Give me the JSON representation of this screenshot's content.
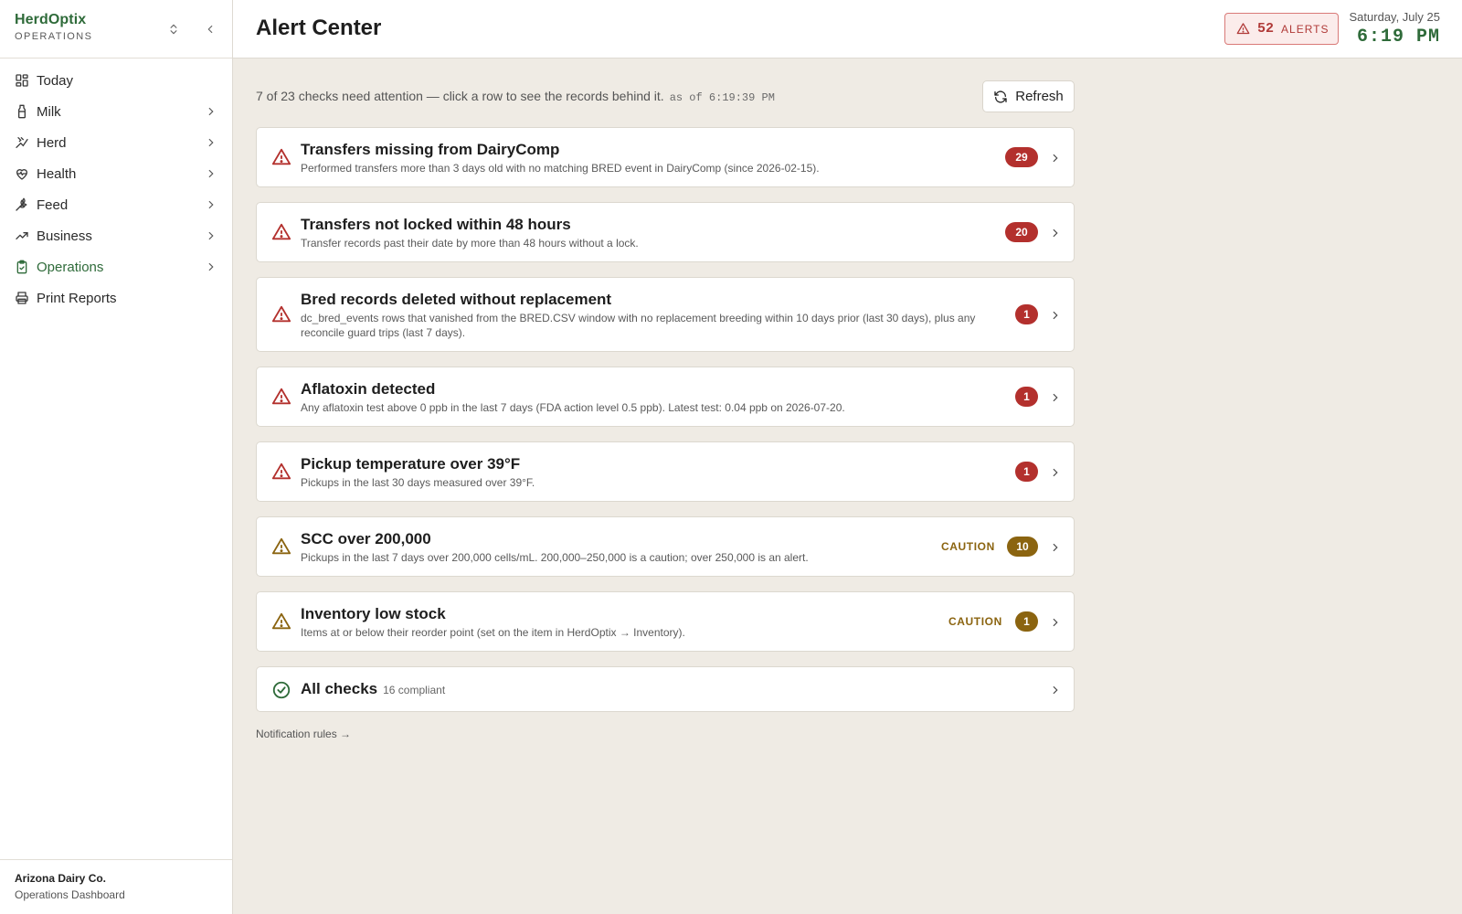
{
  "brand": {
    "name": "HerdOptix",
    "subtitle": "OPERATIONS"
  },
  "sidebar": {
    "items": [
      {
        "label": "Today",
        "icon": "dashboard-icon"
      },
      {
        "label": "Milk",
        "icon": "milk-bottle-icon"
      },
      {
        "label": "Herd",
        "icon": "cow-icon"
      },
      {
        "label": "Health",
        "icon": "heart-pulse-icon"
      },
      {
        "label": "Feed",
        "icon": "wheat-icon"
      },
      {
        "label": "Business",
        "icon": "trending-up-icon"
      },
      {
        "label": "Operations",
        "icon": "clipboard-check-icon"
      },
      {
        "label": "Print Reports",
        "icon": "printer-icon"
      }
    ],
    "footer": {
      "org": "Arizona Dairy Co.",
      "subtitle": "Operations Dashboard"
    }
  },
  "header": {
    "title": "Alert Center",
    "alerts": {
      "count": "52",
      "label": "ALERTS"
    },
    "date": "Saturday, July 25",
    "time": "6:19 PM"
  },
  "summary": {
    "text": "7 of 23 checks need attention — click a row to see the records behind it.",
    "as_of": "as of 6:19:39 PM",
    "refresh_label": "Refresh"
  },
  "checks": [
    {
      "title": "Transfers missing from DairyComp",
      "description": "Performed transfers more than 3 days old with no matching BRED event in DairyComp (since 2026-02-15).",
      "count": "29",
      "severity": "alert"
    },
    {
      "title": "Transfers not locked within 48 hours",
      "description": "Transfer records past their date by more than 48 hours without a lock.",
      "count": "20",
      "severity": "alert"
    },
    {
      "title": "Bred records deleted without replacement",
      "description": "dc_bred_events rows that vanished from the BRED.CSV window with no replacement breeding within 10 days prior (last 30 days), plus any reconcile guard trips (last 7 days).",
      "count": "1",
      "severity": "alert"
    },
    {
      "title": "Aflatoxin detected",
      "description": "Any aflatoxin test above 0 ppb in the last 7 days (FDA action level 0.5 ppb). Latest test: 0.04 ppb on 2026-07-20.",
      "count": "1",
      "severity": "alert"
    },
    {
      "title": "Pickup temperature over 39°F",
      "description": "Pickups in the last 30 days measured over 39°F.",
      "count": "1",
      "severity": "alert"
    },
    {
      "title": "SCC over 200,000",
      "description": "Pickups in the last 7 days over 200,000 cells/mL. 200,000–250,000 is a caution; over 250,000 is an alert.",
      "count": "10",
      "severity": "caution",
      "caution_label": "CAUTION"
    },
    {
      "title": "Inventory low stock",
      "description": "Items at or below their reorder point (set on the item in HerdOptix → Inventory).",
      "count": "1",
      "severity": "caution",
      "caution_label": "CAUTION"
    }
  ],
  "all_checks": {
    "title": "All checks",
    "compliant": "16 compliant"
  },
  "notification_rules": "Notification rules →",
  "colors": {
    "brand_green": "#2f6b3a",
    "alert_red": "#b3302d",
    "caution_amber": "#8b6410",
    "background": "#efebe4"
  }
}
